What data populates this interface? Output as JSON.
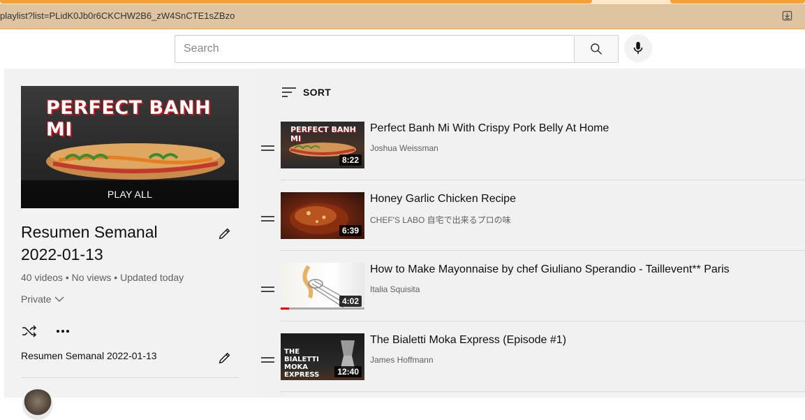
{
  "browser": {
    "url": "playlist?list=PLidK0Jb0r6CKCHW2B6_zW4SnCTE1sZBzo"
  },
  "search": {
    "placeholder": "Search"
  },
  "playlist": {
    "hero_text": "PERFECT BANH MI",
    "play_all_label": "PLAY ALL",
    "title": "Resumen Semanal 2022-01-13",
    "stats": "40 videos • No views • Updated today",
    "privacy": "Private",
    "description": "Resumen Semanal 2022-01-13"
  },
  "list": {
    "sort_label": "SORT",
    "videos": [
      {
        "title": "Perfect Banh Mi With Crispy Pork Belly At Home",
        "channel": "Joshua Weissman",
        "duration": "8:22",
        "thumb_text": "PERFECT BANH MI"
      },
      {
        "title": "Honey Garlic Chicken Recipe",
        "channel": "CHEF'S LABO 自宅で出来るプロの味",
        "duration": "6:39"
      },
      {
        "title": "How to Make Mayonnaise by chef Giuliano Sperandio - Taillevent** Paris",
        "channel": "Italia Squisita",
        "duration": "4:02"
      },
      {
        "title": "The Bialetti Moka Express (Episode #1)",
        "channel": "James Hoffmann",
        "duration": "12:40",
        "thumb_text": "THE BIALETTI MOKA EXPRESS"
      }
    ]
  },
  "colors": {
    "tab_accent": "#f7a035",
    "address_bar": "#dfc4a1",
    "panel_bg": "#f2f2f2"
  },
  "icons": [
    "download-icon",
    "search-icon",
    "mic-icon",
    "pencil-icon",
    "chevron-down-icon",
    "shuffle-icon",
    "more-icon",
    "sort-icon",
    "drag-handle-icon"
  ]
}
